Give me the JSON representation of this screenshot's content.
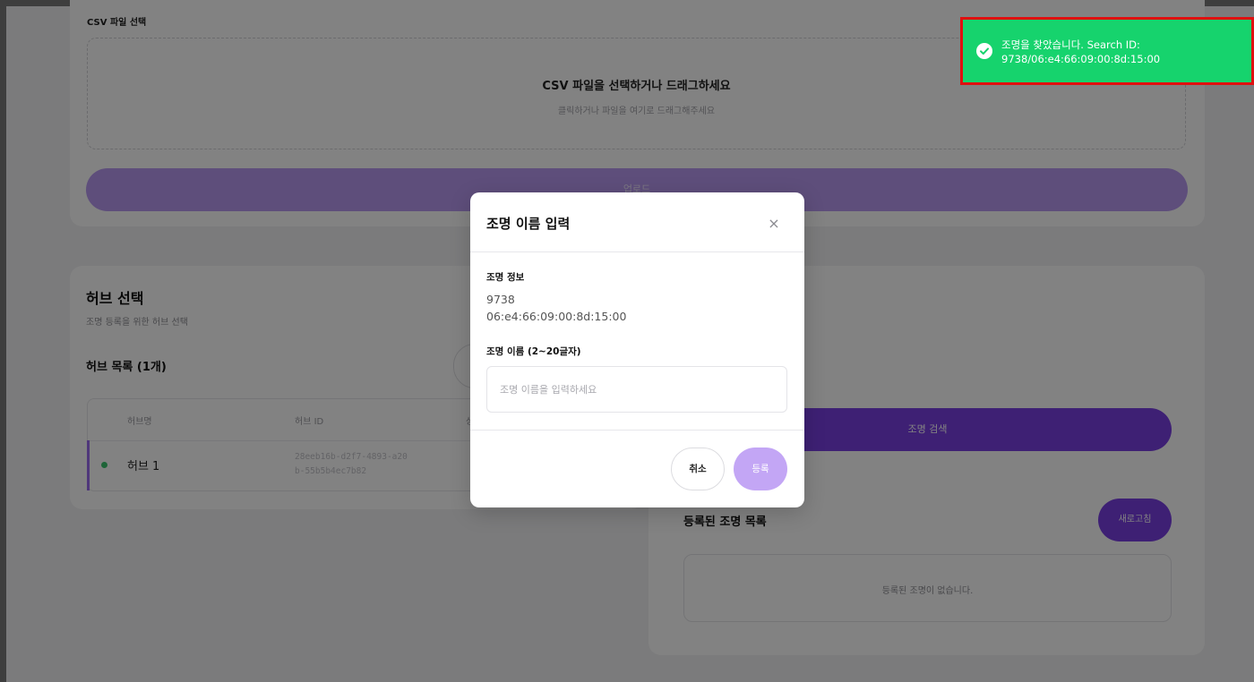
{
  "csv": {
    "section_label": "CSV 파일 선택",
    "drop_title": "CSV 파일을 선택하거나 드래그하세요",
    "drop_subtitle": "클릭하거나 파일을 여기로 드래그해주세요",
    "upload_label": "업로드"
  },
  "hub": {
    "title": "허브 선택",
    "subtitle": "조명 등록을 위한 허브 선택",
    "list_title": "허브 목록 (1개)",
    "columns": [
      "허브명",
      "허브 ID",
      "상"
    ],
    "rows": [
      {
        "name": "허브 1",
        "id": "28eeb16b-d2f7-4893-a20b-55b5b4ec7b82",
        "status": "online"
      }
    ]
  },
  "light": {
    "search_label": "조명 검색",
    "registered_title": "등록된 조명 목록",
    "refresh_label": "새로고침",
    "empty_text": "등록된 조명이 없습니다."
  },
  "modal": {
    "title": "조명 이름 입력",
    "close_glyph": "×",
    "info_label": "조명 정보",
    "info_line1": "9738",
    "info_line2": "06:e4:66:09:00:8d:15:00",
    "name_label": "조명 이름 (2~20글자)",
    "name_placeholder": "조명 이름을 입력하세요",
    "name_value": "",
    "cancel_label": "취소",
    "submit_label": "등록"
  },
  "toast": {
    "message": "조명을 찾았습니다. Search ID: 9738/06:e4:66:09:00:8d:15:00",
    "icon": "check-circle-icon",
    "color": "#16d36d",
    "highlight_color": "#e01010"
  },
  "colors": {
    "accent": "#7b3fe4",
    "accent_light": "#c3a6f5",
    "online": "#3cc56e"
  }
}
